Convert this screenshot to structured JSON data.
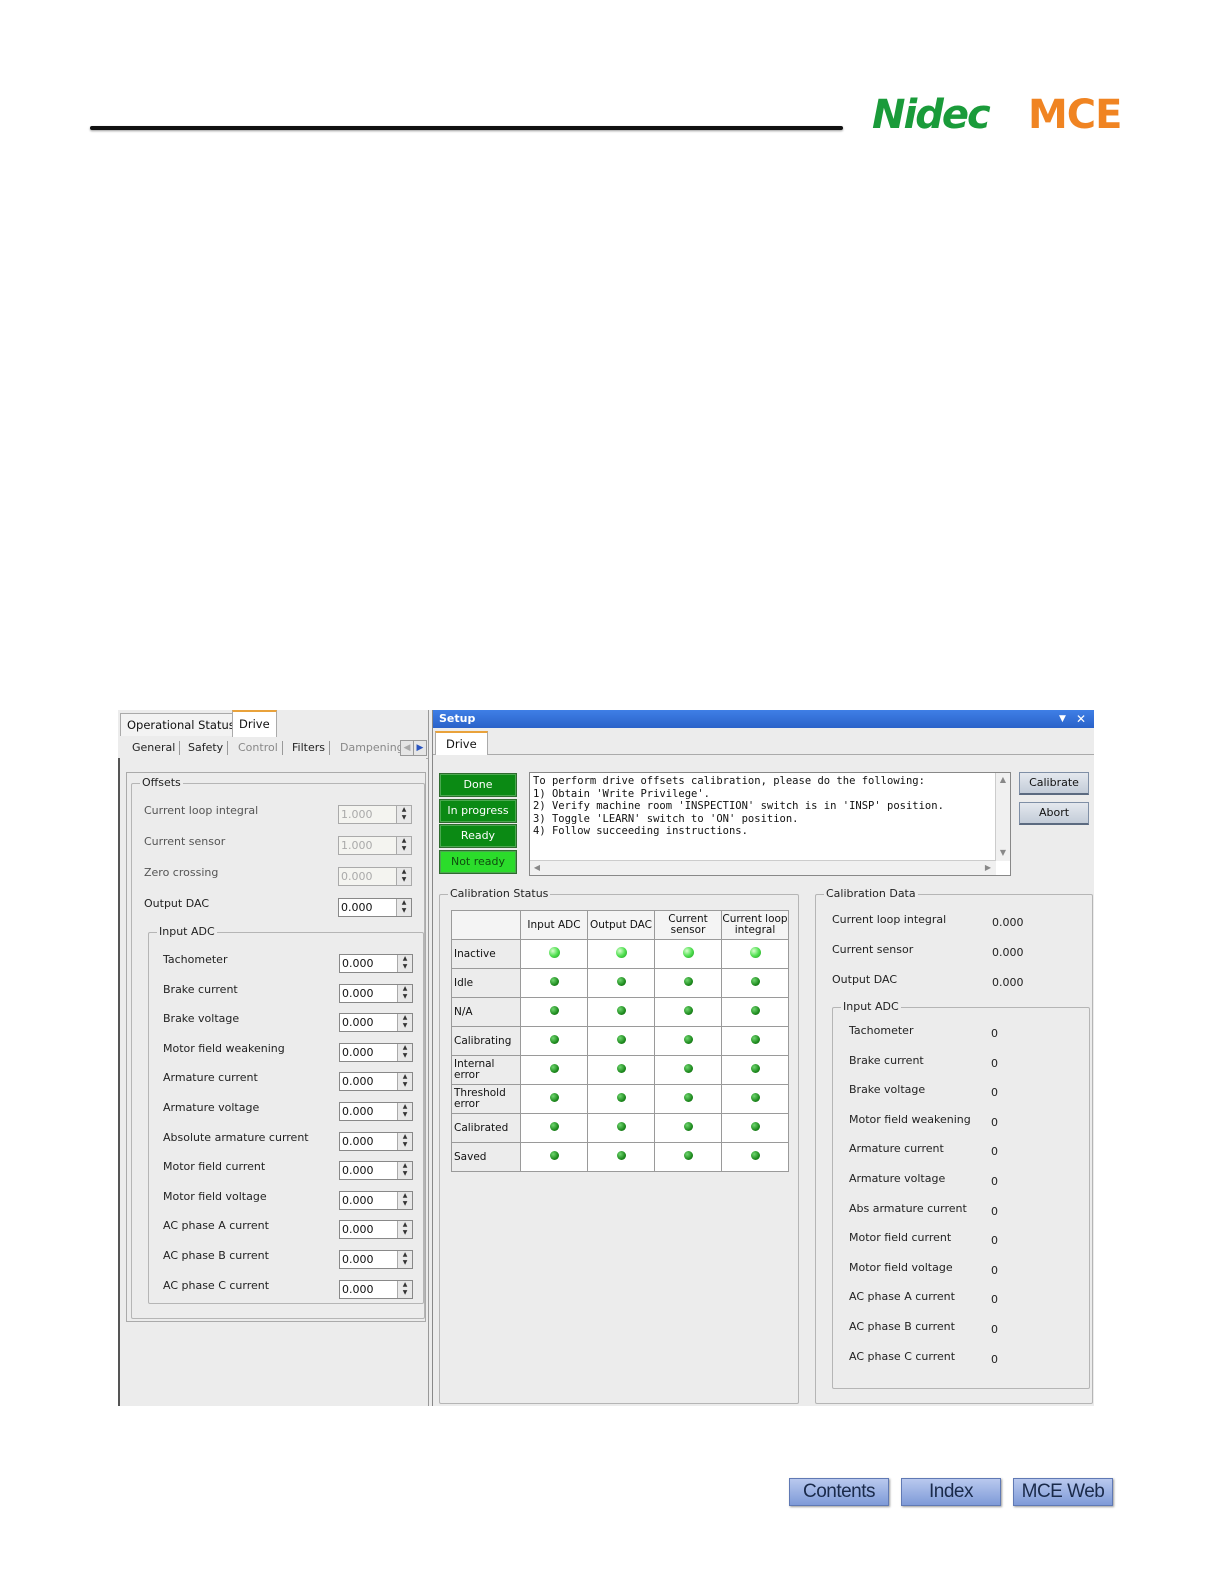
{
  "header": {
    "logo_left": "Nidec",
    "logo_right": "MCE"
  },
  "left_panel": {
    "top_tabs": [
      "Operational Status",
      "Drive"
    ],
    "active_top_tab": "Drive",
    "sub_tabs": [
      "General",
      "Safety",
      "Control",
      "Filters",
      "Dampening"
    ],
    "offsets_title": "Offsets",
    "offsets": [
      {
        "label": "Current loop integral",
        "value": "1.000",
        "disabled": true
      },
      {
        "label": "Current sensor",
        "value": "1.000",
        "disabled": true
      },
      {
        "label": "Zero crossing",
        "value": "0.000",
        "disabled": true
      },
      {
        "label": "Output DAC",
        "value": "0.000",
        "disabled": false
      }
    ],
    "input_adc_title": "Input ADC",
    "input_adc": [
      {
        "label": "Tachometer",
        "value": "0.000"
      },
      {
        "label": "Brake current",
        "value": "0.000"
      },
      {
        "label": "Brake voltage",
        "value": "0.000"
      },
      {
        "label": "Motor field weakening",
        "value": "0.000"
      },
      {
        "label": "Armature current",
        "value": "0.000"
      },
      {
        "label": "Armature voltage",
        "value": "0.000"
      },
      {
        "label": "Absolute armature current",
        "value": "0.000"
      },
      {
        "label": "Motor field current",
        "value": "0.000"
      },
      {
        "label": "Motor field voltage",
        "value": "0.000"
      },
      {
        "label": "AC phase A current",
        "value": "0.000"
      },
      {
        "label": "AC phase B current",
        "value": "0.000"
      },
      {
        "label": "AC phase C current",
        "value": "0.000"
      }
    ]
  },
  "setup": {
    "title": "Setup",
    "tab": "Drive",
    "status_buttons": [
      "Done",
      "In progress",
      "Ready",
      "Not ready"
    ],
    "active_status": "Not ready",
    "message_lines": [
      "To perform drive offsets calibration, please do the following:",
      "1) Obtain 'Write Privilege'.",
      "2) Verify machine room 'INSPECTION' switch is in 'INSP' position.",
      "3) Toggle 'LEARN' switch to 'ON' position.",
      "4) Follow succeeding instructions."
    ],
    "calibrate_label": "Calibrate",
    "abort_label": "Abort",
    "calibration_status": {
      "title": "Calibration Status",
      "columns": [
        "Input ADC",
        "Output DAC",
        "Current sensor",
        "Current loop integral"
      ],
      "rows": [
        {
          "label": "Inactive",
          "lit": [
            true,
            true,
            true,
            true
          ]
        },
        {
          "label": "Idle",
          "lit": [
            false,
            false,
            false,
            false
          ]
        },
        {
          "label": "N/A",
          "lit": [
            false,
            false,
            false,
            false
          ]
        },
        {
          "label": "Calibrating",
          "lit": [
            false,
            false,
            false,
            false
          ]
        },
        {
          "label": "Internal error",
          "lit": [
            false,
            false,
            false,
            false
          ]
        },
        {
          "label": "Threshold error",
          "lit": [
            false,
            false,
            false,
            false
          ]
        },
        {
          "label": "Calibrated",
          "lit": [
            false,
            false,
            false,
            false
          ]
        },
        {
          "label": "Saved",
          "lit": [
            false,
            false,
            false,
            false
          ]
        }
      ]
    },
    "calibration_data": {
      "title": "Calibration Data",
      "items": [
        {
          "label": "Current loop integral",
          "value": "0.000"
        },
        {
          "label": "Current sensor",
          "value": "0.000"
        },
        {
          "label": "Output DAC",
          "value": "0.000"
        }
      ],
      "input_adc_title": "Input ADC",
      "input_adc": [
        {
          "label": "Tachometer",
          "value": "0"
        },
        {
          "label": "Brake current",
          "value": "0"
        },
        {
          "label": "Brake voltage",
          "value": "0"
        },
        {
          "label": "Motor field weakening",
          "value": "0"
        },
        {
          "label": "Armature current",
          "value": "0"
        },
        {
          "label": "Armature voltage",
          "value": "0"
        },
        {
          "label": "Abs armature current",
          "value": "0"
        },
        {
          "label": "Motor field current",
          "value": "0"
        },
        {
          "label": "Motor field voltage",
          "value": "0"
        },
        {
          "label": "AC phase A current",
          "value": "0"
        },
        {
          "label": "AC phase B current",
          "value": "0"
        },
        {
          "label": "AC phase C current",
          "value": "0"
        }
      ]
    }
  },
  "footer": {
    "buttons": [
      "Contents",
      "Index",
      "MCE Web"
    ]
  }
}
